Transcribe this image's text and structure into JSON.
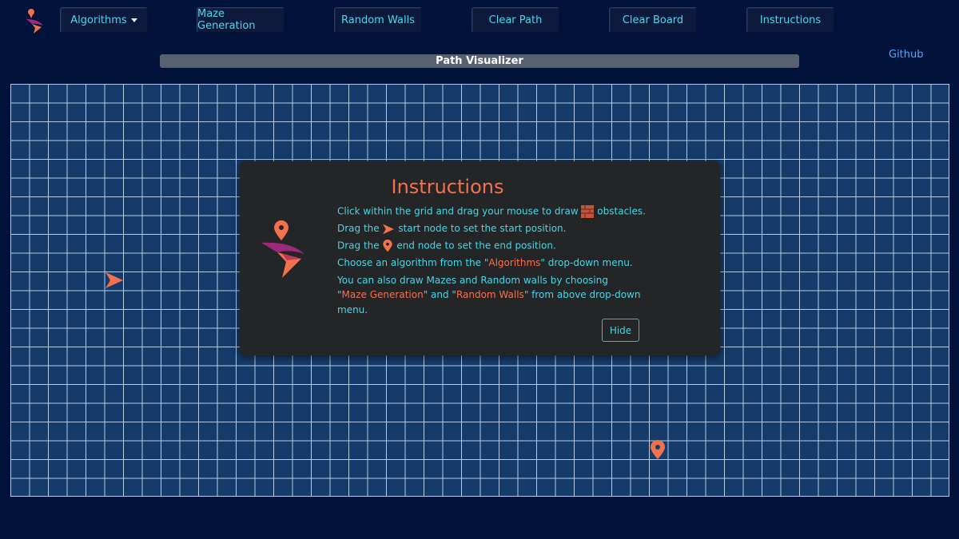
{
  "navbar": {
    "algorithms_label": "Algorithms",
    "maze_label": "Maze Generation",
    "random_label": "Random Walls",
    "clear_path_label": "Clear Path",
    "clear_board_label": "Clear Board",
    "instructions_label": "Instructions"
  },
  "github_label": "Github",
  "page_title": "Path Visualizer",
  "modal": {
    "title": "Instructions",
    "line1_a": "Click within the grid and drag your mouse to draw",
    "line1_b": "obstacles.",
    "line2_a": "Drag the",
    "line2_b": "start node to set the start position.",
    "line3_a": "Drag the",
    "line3_b": "end node to set the end position.",
    "line4_a": "Choose an algorithm from the \"",
    "line4_hl": "Algorithms",
    "line4_b": "\" drop-down menu.",
    "line5": "You can also draw Mazes and Random walls by choosing",
    "line6_a": "\"",
    "line6_hl1": "Maze Generation",
    "line6_b": "\" and \"",
    "line6_hl2": "Random Walls",
    "line6_c": "\" from above drop-down",
    "line7": "menu.",
    "hide_label": "Hide"
  },
  "colors": {
    "background": "#01123a",
    "grid_cell": "#143b6a",
    "grid_line": "#b6cce4",
    "accent_orange": "#f4714e",
    "accent_cyan": "#45d7e8",
    "modal_bg": "#242526"
  },
  "icons": [
    "logo-icon",
    "caret-down-icon",
    "start-arrow-icon",
    "end-pin-icon",
    "wall-block-icon"
  ]
}
